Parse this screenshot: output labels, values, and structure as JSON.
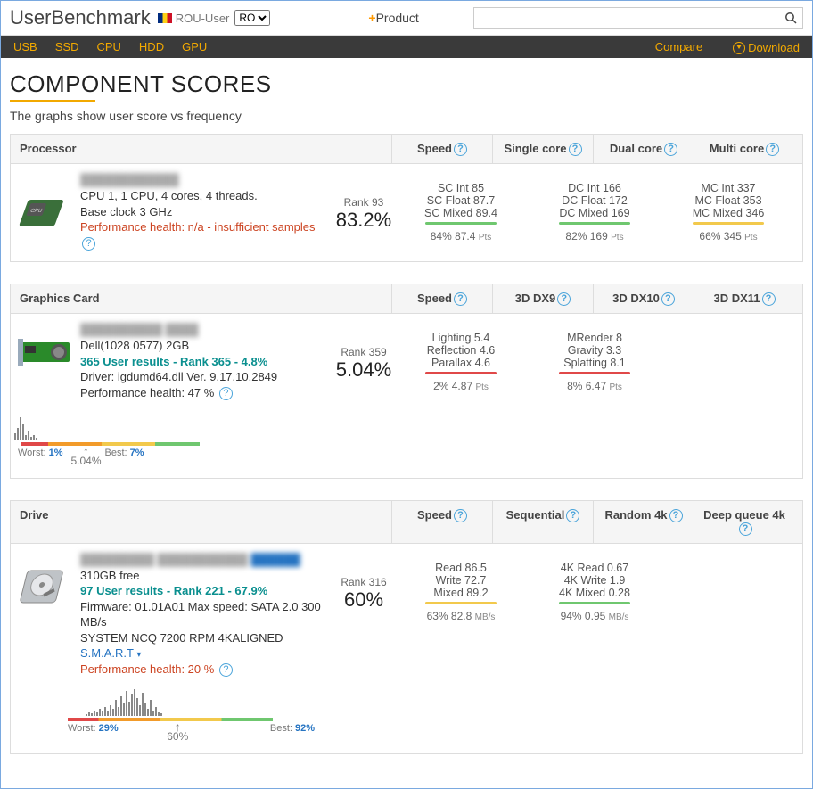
{
  "header": {
    "site": "UserBenchmark",
    "country_user": "ROU-User",
    "locale": "RO",
    "product_label": "Product",
    "search_placeholder": ""
  },
  "nav": {
    "items": [
      "USB",
      "SSD",
      "CPU",
      "HDD",
      "GPU"
    ],
    "compare": "Compare",
    "download": "Download"
  },
  "title": "COMPONENT SCORES",
  "subtitle": "The graphs show user score vs frequency",
  "cpu": {
    "name": "Processor",
    "cols": {
      "c1": "Speed",
      "c2": "Single core",
      "c3": "Dual core",
      "c4": "Multi core"
    },
    "info1": "CPU 1, 1 CPU, 4 cores, 4 threads.",
    "info2": "Base clock 3 GHz",
    "health": "Performance health: n/a - insufficient samples",
    "rank": "Rank 93",
    "pct": "83.2%",
    "sc": {
      "l1": "SC Int 85",
      "l2": "SC Float 87.7",
      "l3": "SC Mixed 89.4",
      "sum": "84% 87.4",
      "unit": "Pts"
    },
    "dc": {
      "l1": "DC Int 166",
      "l2": "DC Float 172",
      "l3": "DC Mixed 169",
      "sum": "82% 169",
      "unit": "Pts"
    },
    "mc": {
      "l1": "MC Int 337",
      "l2": "MC Float 353",
      "l3": "MC Mixed 346",
      "sum": "66% 345",
      "unit": "Pts"
    }
  },
  "gpu": {
    "name": "Graphics Card",
    "cols": {
      "c1": "Speed",
      "c2": "3D DX9",
      "c3": "3D DX10",
      "c4": "3D DX11"
    },
    "info0": "Dell(1028 0577) 2GB",
    "results": "365 User results - Rank 365 - 4.8%",
    "driver": "Driver: igdumd64.dll Ver. 9.17.10.2849",
    "health": "Performance health: 47 %",
    "rank": "Rank 359",
    "pct": "5.04%",
    "dx9": {
      "l1": "Lighting 5.4",
      "l2": "Reflection 4.6",
      "l3": "Parallax 4.6",
      "sum": "2% 4.87",
      "unit": "Pts"
    },
    "dx10": {
      "l1": "MRender 8",
      "l2": "Gravity 3.3",
      "l3": "Splatting 8.1",
      "sum": "8% 6.47",
      "unit": "Pts"
    },
    "hist": {
      "worst_l": "Worst:",
      "worst_v": "1%",
      "best_l": "Best:",
      "best_v": "7%",
      "marker": "5.04%"
    }
  },
  "drive": {
    "name": "Drive",
    "cols": {
      "c1": "Speed",
      "c2": "Sequential",
      "c3": "Random 4k",
      "c4": "Deep queue 4k"
    },
    "free": "310GB free",
    "results": "97 User results - Rank 221 - 67.9%",
    "fw": "Firmware: 01.01A01 Max speed: SATA 2.0 300 MB/s",
    "sys": "SYSTEM NCQ 7200 RPM 4KALIGNED",
    "smart": "S.M.A.R.T",
    "health": "Performance health: 20 %",
    "rank": "Rank 316",
    "pct": "60%",
    "seq": {
      "l1": "Read 86.5",
      "l2": "Write 72.7",
      "l3": "Mixed 89.2",
      "sum": "63% 82.8",
      "unit": "MB/s"
    },
    "r4k": {
      "l1": "4K Read 0.67",
      "l2": "4K Write 1.9",
      "l3": "4K Mixed 0.28",
      "sum": "94% 0.95",
      "unit": "MB/s"
    },
    "hist": {
      "worst_l": "Worst:",
      "worst_v": "29%",
      "best_l": "Best:",
      "best_v": "92%",
      "marker": "60%"
    }
  }
}
